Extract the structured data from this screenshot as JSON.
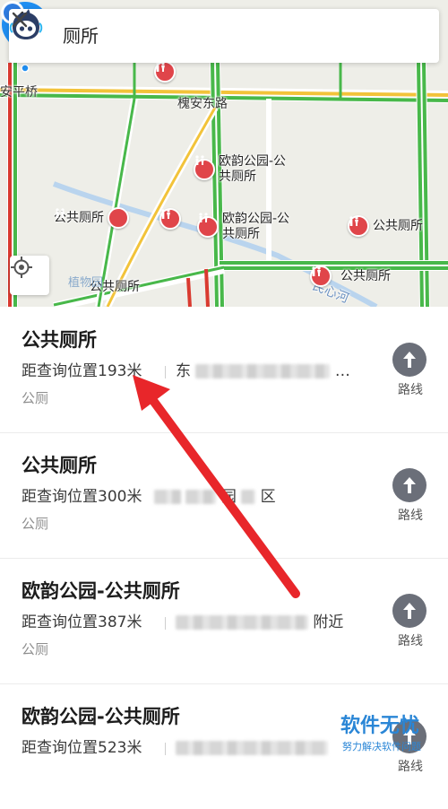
{
  "search": {
    "query": "厕所"
  },
  "map": {
    "road_labels": [
      "安平桥",
      "槐安东路",
      "民心河",
      "植物园"
    ],
    "poi_labels": [
      "欧韵公园-公共厕所",
      "公共厕所",
      "欧韵公园-公共厕所",
      "公共厕所",
      "公共厕所",
      "公共厕所"
    ],
    "poi_label_bottom_right": "公共厕所"
  },
  "results": [
    {
      "title": "公共厕所",
      "distance": "距查询位置193米",
      "address_visible": "东",
      "address_tail": "…",
      "category": "公厕",
      "route_label": "路线"
    },
    {
      "title": "公共厕所",
      "distance": "距查询位置300米",
      "address_visible": "园",
      "address_tail": "区",
      "category": "公厕",
      "route_label": "路线"
    },
    {
      "title": "欧韵公园-公共厕所",
      "distance": "距查询位置387米",
      "address_visible": "",
      "address_tail": "附近",
      "category": "公厕",
      "route_label": "路线"
    },
    {
      "title": "欧韵公园-公共厕所",
      "distance": "距查询位置523米",
      "address_visible": "",
      "address_tail": "",
      "category": "",
      "route_label": "路线"
    }
  ],
  "watermark": {
    "main": "软件无忧",
    "sub": "努力解决软件问题"
  },
  "colors": {
    "poi_red": "#e0454a",
    "pin_blue": "#1f8ef1",
    "route_gray": "#6b6f79",
    "annotation_red": "#e8262a",
    "watermark_blue": "#2a86d6"
  }
}
